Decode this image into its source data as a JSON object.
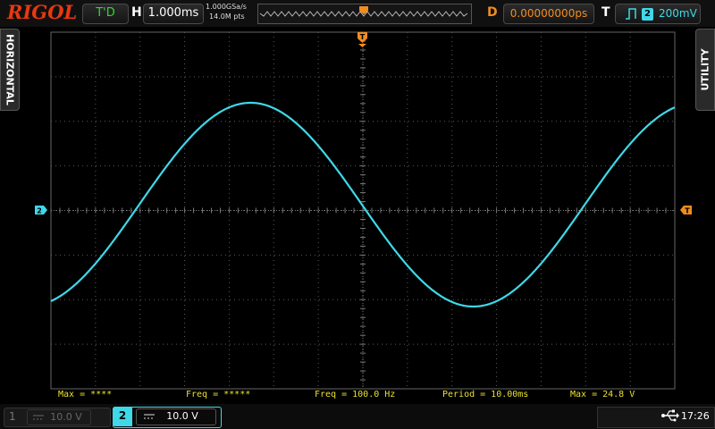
{
  "brand": "RIGOL",
  "topbar": {
    "trigger_state": "T'D",
    "h_label": "H",
    "timebase": "1.000ms",
    "sample_rate": "1.000GSa/s",
    "memory_depth": "14.0M pts",
    "d_label": "D",
    "delay": "0.00000000ps",
    "t_label": "T",
    "trigger_source": "2",
    "trigger_level": "200mV"
  },
  "side_tabs": {
    "left": "HORIZONTAL",
    "right": "UTILITY"
  },
  "markers": {
    "trigger_position": "T",
    "channel2_ground": "2",
    "trigger_level": "T"
  },
  "measurements": [
    "Max = ****",
    "Freq = *****",
    "Freq = 100.0 Hz",
    "Period = 10.00ms",
    "Max = 24.8 V"
  ],
  "bottombar": {
    "ch1_number": "1",
    "ch1_scale": "10.0 V",
    "ch2_number": "2",
    "ch2_scale": "10.0 V",
    "time": "17:26"
  },
  "colors": {
    "brand": "#e8380f",
    "trace": "#3fd8e8",
    "trigger": "#f08c20",
    "measurement": "#e8e030",
    "triggered": "#35d435"
  }
}
